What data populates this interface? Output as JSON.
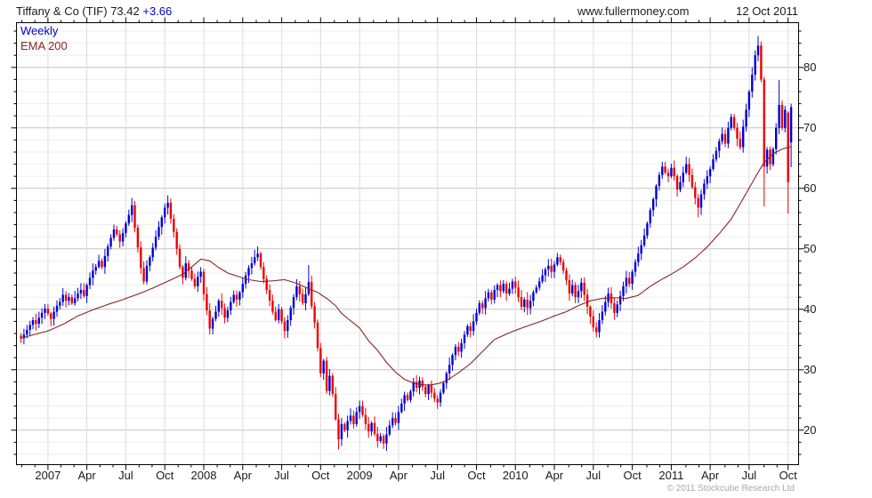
{
  "header": {
    "instrument": "Tiffany & Co (TIF)",
    "last_price": "73.42",
    "change": "+3.66",
    "site": "www.fullermoney.com",
    "date": "12 Oct 2011"
  },
  "legend": {
    "series": "Weekly",
    "overlay": "EMA 200"
  },
  "footer": {
    "copyright": "© 2011 Stockcube Research Ltd"
  },
  "chart_data": {
    "type": "candlestick",
    "title": "Tiffany & Co (TIF) 73.42 +3.66",
    "period": "weekly",
    "y_axis": {
      "min": 14.3,
      "max": 87.4,
      "tick_labels": [
        20,
        30,
        40,
        50,
        60,
        70,
        80
      ],
      "minor_step": 2,
      "side": "right"
    },
    "x_axis": {
      "ticks": [
        {
          "label": "2007",
          "week": 9
        },
        {
          "label": "Apr",
          "week": 22
        },
        {
          "label": "Jul",
          "week": 35
        },
        {
          "label": "Oct",
          "week": 48
        },
        {
          "label": "2008",
          "week": 61
        },
        {
          "label": "Apr",
          "week": 74
        },
        {
          "label": "Jul",
          "week": 87
        },
        {
          "label": "Oct",
          "week": 100
        },
        {
          "label": "2009",
          "week": 113
        },
        {
          "label": "Apr",
          "week": 126
        },
        {
          "label": "Jul",
          "week": 139
        },
        {
          "label": "Oct",
          "week": 152
        },
        {
          "label": "2010",
          "week": 165
        },
        {
          "label": "Apr",
          "week": 178
        },
        {
          "label": "Jul",
          "week": 191
        },
        {
          "label": "Oct",
          "week": 204
        },
        {
          "label": "2011",
          "week": 217
        },
        {
          "label": "Apr",
          "week": 230
        },
        {
          "label": "Jul",
          "week": 243
        },
        {
          "label": "Oct",
          "week": 256
        }
      ],
      "minor": "monthly"
    },
    "weeks_total": 258,
    "first_open": 35.6,
    "closes": [
      35.2,
      35.8,
      36.6,
      37.4,
      38.2,
      37.6,
      38.6,
      39.4,
      40.1,
      39.3,
      38.4,
      39.6,
      40.6,
      41.2,
      42.4,
      41.4,
      42.0,
      41.0,
      41.8,
      42.6,
      43.2,
      42.2,
      44.0,
      45.2,
      46.4,
      47.0,
      48.0,
      47.0,
      48.8,
      50.4,
      51.8,
      53.2,
      52.4,
      51.2,
      52.6,
      54.2,
      55.6,
      57.2,
      53.5,
      50.2,
      46.8,
      44.6,
      47.2,
      48.6,
      50.2,
      52.0,
      53.6,
      55.2,
      56.8,
      57.6,
      55.0,
      52.8,
      50.0,
      47.0,
      45.2,
      47.6,
      46.4,
      45.0,
      43.8,
      45.4,
      46.2,
      42.5,
      39.8,
      36.8,
      38.4,
      39.6,
      41.4,
      40.2,
      38.6,
      39.8,
      41.2,
      42.4,
      41.6,
      42.8,
      44.2,
      45.6,
      46.8,
      47.6,
      48.6,
      49.2,
      47.0,
      45.0,
      43.2,
      41.4,
      39.6,
      38.2,
      40.0,
      38.0,
      36.4,
      38.2,
      40.2,
      42.0,
      43.8,
      42.5,
      41.0,
      42.5,
      44.5,
      40.5,
      37.8,
      33.6,
      29.4,
      31.5,
      26.5,
      29.0,
      26.0,
      21.8,
      18.5,
      21.0,
      20.0,
      21.5,
      22.4,
      21.0,
      23.0,
      24.0,
      22.5,
      21.0,
      19.8,
      21.2,
      19.4,
      18.2,
      19.0,
      17.8,
      19.3,
      20.8,
      22.0,
      21.2,
      23.0,
      24.4,
      25.8,
      25.0,
      26.4,
      28.0,
      27.0,
      28.2,
      27.2,
      26.0,
      27.4,
      26.2,
      25.2,
      24.6,
      26.2,
      27.8,
      29.4,
      30.8,
      32.4,
      33.8,
      33.0,
      34.4,
      35.8,
      37.2,
      36.4,
      38.0,
      39.4,
      41.0,
      40.2,
      41.8,
      42.8,
      41.6,
      43.2,
      44.0,
      43.0,
      44.2,
      42.6,
      43.4,
      44.6,
      43.6,
      42.0,
      40.4,
      41.6,
      40.2,
      41.4,
      42.8,
      43.6,
      44.6,
      45.6,
      46.6,
      47.2,
      46.2,
      47.4,
      48.6,
      47.8,
      46.4,
      44.8,
      42.6,
      44.0,
      42.0,
      43.0,
      44.4,
      42.4,
      40.4,
      38.8,
      37.0,
      36.2,
      38.2,
      39.6,
      41.2,
      42.6,
      41.0,
      39.4,
      40.8,
      42.2,
      43.8,
      45.2,
      44.2,
      46.2,
      47.8,
      49.2,
      50.6,
      52.2,
      54.2,
      56.4,
      58.2,
      60.4,
      62.2,
      63.6,
      62.6,
      62.0,
      63.4,
      62.0,
      59.8,
      61.0,
      62.6,
      64.0,
      62.2,
      60.2,
      58.4,
      56.8,
      59.0,
      60.8,
      62.0,
      63.2,
      64.8,
      66.2,
      67.8,
      69.0,
      67.4,
      70.0,
      71.8,
      70.0,
      68.2,
      66.8,
      70.2,
      73.0,
      76.0,
      78.8,
      82.0,
      83.6,
      78.0,
      63.6,
      66.4,
      64.0,
      66.5,
      70.0,
      73.8,
      70.0,
      73.0,
      61.0,
      73.42
    ],
    "wick_overrides": {
      "38": {
        "h": 57.9
      },
      "50": {
        "h": 58.3
      },
      "79": {
        "h": 50.4
      },
      "96": {
        "h": 47.3
      },
      "106": {
        "l": 16.8
      },
      "121": {
        "l": 16.9
      },
      "192": {
        "l": 35.3
      },
      "226": {
        "l": 55.2
      },
      "246": {
        "h": 85.2
      },
      "247": {
        "h": 84.3
      },
      "248": {
        "l": 57.0
      },
      "253": {
        "h": 77.9
      },
      "256": {
        "o": 72.5,
        "l": 55.8
      },
      "257": {
        "o": 67.6,
        "h": 74.0,
        "l": 63.5
      }
    },
    "overlay": {
      "name": "EMA 200",
      "period_days": 200,
      "anchors": [
        [
          0,
          35.2
        ],
        [
          5,
          35.9
        ],
        [
          9,
          36.4
        ],
        [
          14,
          37.5
        ],
        [
          19,
          38.9
        ],
        [
          24,
          39.9
        ],
        [
          29,
          40.8
        ],
        [
          34,
          41.6
        ],
        [
          39,
          42.5
        ],
        [
          44,
          43.5
        ],
        [
          48,
          44.4
        ],
        [
          51,
          45.1
        ],
        [
          54,
          45.8
        ],
        [
          57,
          47.0
        ],
        [
          60,
          48.3
        ],
        [
          63,
          48.0
        ],
        [
          66,
          46.9
        ],
        [
          69,
          46.0
        ],
        [
          72,
          45.5
        ],
        [
          76,
          44.9
        ],
        [
          80,
          44.6
        ],
        [
          84,
          44.7
        ],
        [
          88,
          44.9
        ],
        [
          92,
          44.3
        ],
        [
          96,
          43.4
        ],
        [
          99,
          42.8
        ],
        [
          102,
          41.8
        ],
        [
          105,
          40.6
        ],
        [
          107,
          39.3
        ],
        [
          110,
          38.1
        ],
        [
          113,
          36.9
        ],
        [
          116,
          34.8
        ],
        [
          119,
          33.2
        ],
        [
          122,
          31.2
        ],
        [
          125,
          29.6
        ],
        [
          128,
          28.4
        ],
        [
          131,
          27.8
        ],
        [
          134,
          27.5
        ],
        [
          137,
          27.5
        ],
        [
          140,
          27.8
        ],
        [
          143,
          28.5
        ],
        [
          146,
          29.5
        ],
        [
          150,
          31.0
        ],
        [
          154,
          33.0
        ],
        [
          158,
          35.0
        ],
        [
          162,
          35.9
        ],
        [
          166,
          36.7
        ],
        [
          170,
          37.4
        ],
        [
          174,
          38.1
        ],
        [
          178,
          38.9
        ],
        [
          182,
          39.6
        ],
        [
          186,
          40.6
        ],
        [
          190,
          41.4
        ],
        [
          194,
          41.8
        ],
        [
          198,
          41.9
        ],
        [
          202,
          41.8
        ],
        [
          206,
          42.3
        ],
        [
          210,
          43.8
        ],
        [
          214,
          45.0
        ],
        [
          217,
          45.8
        ],
        [
          221,
          47.0
        ],
        [
          225,
          48.5
        ],
        [
          229,
          50.3
        ],
        [
          233,
          52.5
        ],
        [
          237,
          54.9
        ],
        [
          241,
          58.3
        ],
        [
          245,
          61.8
        ],
        [
          248,
          64.3
        ],
        [
          251,
          65.7
        ],
        [
          254,
          66.5
        ],
        [
          257,
          66.9
        ]
      ]
    },
    "colors": {
      "up": "#0000d8",
      "down": "#ee0000",
      "ema": "#8b2424",
      "grid_minor": "#ededed",
      "grid_major": "#c3c3c3",
      "grid_vert": "#dcdcdc",
      "border": "#000000"
    }
  }
}
